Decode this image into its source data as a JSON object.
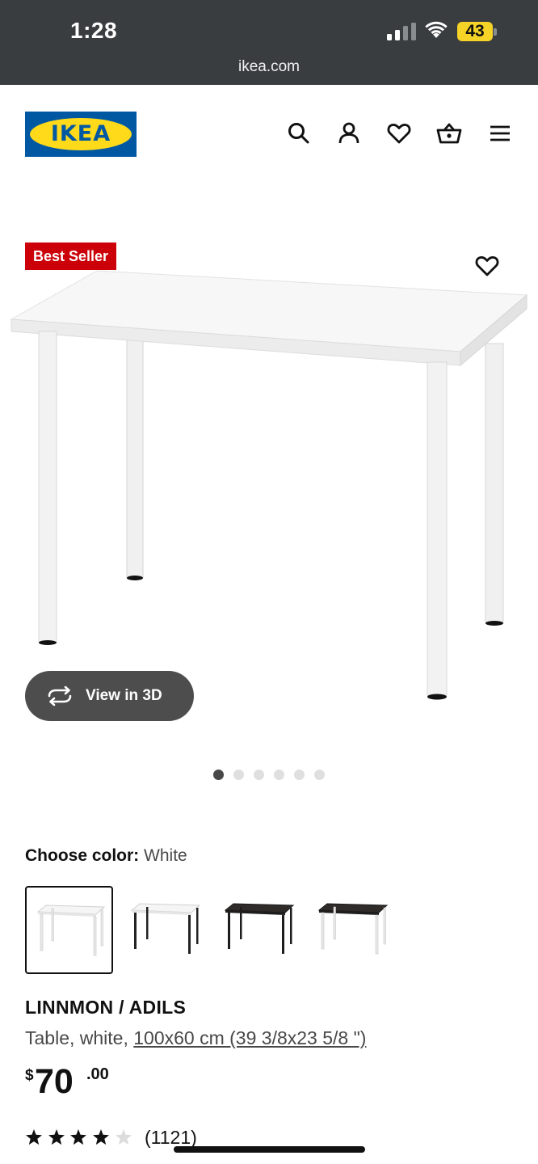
{
  "status_bar": {
    "time": "1:28",
    "battery": "43",
    "url": "ikea.com"
  },
  "header": {
    "logo_text": "IKEA",
    "icons": [
      "search-icon",
      "account-icon",
      "favourites-icon",
      "shopping-bag-icon",
      "menu-icon"
    ]
  },
  "product_media": {
    "badge": "Best Seller",
    "view_3d_label": "View in 3D",
    "image_count": 6,
    "active_image": 1
  },
  "color_choice": {
    "label": "Choose color:",
    "value": "White",
    "options": [
      "white-white",
      "white-black",
      "black-brown-black",
      "black-brown-white"
    ]
  },
  "product": {
    "name": "LINNMON / ADILS",
    "description_prefix": "Table, white, ",
    "dimensions": "100x60 cm (39 3/8x23 5/8 \")",
    "price_currency": "$",
    "price_integer": "70",
    "price_decimal": ".00",
    "rating": 4.5,
    "review_count": "(1121)"
  },
  "colors": {
    "ikea_blue": "#0058a3",
    "ikea_yellow": "#ffda1a",
    "badge_red": "#cc0008",
    "button_grey": "#4d4d4d"
  }
}
